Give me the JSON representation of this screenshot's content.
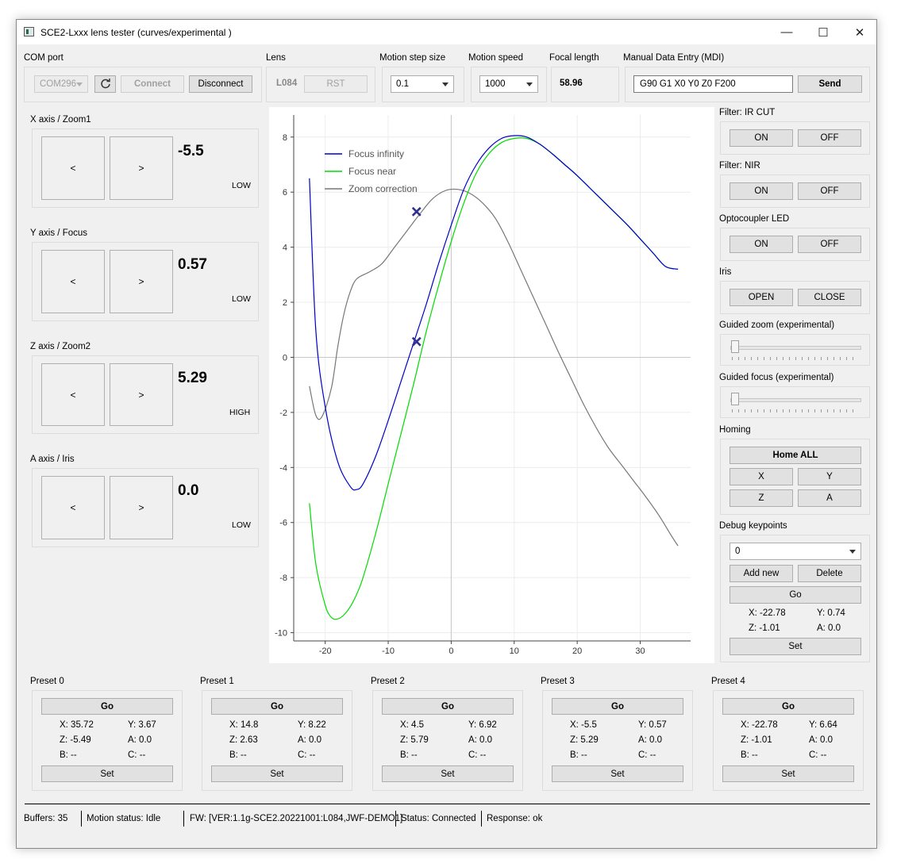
{
  "window": {
    "title": "SCE2-Lxxx lens tester (curves/experimental )",
    "min": "—",
    "max": "☐",
    "close": "✕"
  },
  "com": {
    "label": "COM port",
    "port": "COM296",
    "connect": "Connect",
    "disconnect": "Disconnect"
  },
  "lens": {
    "label": "Lens",
    "value": "L084",
    "rst": "RST"
  },
  "step": {
    "label": "Motion step size",
    "value": "0.1"
  },
  "speed": {
    "label": "Motion speed",
    "value": "1000"
  },
  "focal": {
    "label": "Focal length",
    "value": "58.96"
  },
  "mdi": {
    "label": "Manual Data Entry (MDI)",
    "value": "G90 G1 X0 Y0 Z0 F200",
    "send": "Send"
  },
  "axes": [
    {
      "label": "X axis / Zoom1",
      "value": "-5.5",
      "level": "LOW",
      "left": "<",
      "right": ">"
    },
    {
      "label": "Y axis / Focus",
      "value": "0.57",
      "level": "LOW",
      "left": "<",
      "right": ">"
    },
    {
      "label": "Z axis / Zoom2",
      "value": "5.29",
      "level": "HIGH",
      "left": "<",
      "right": ">"
    },
    {
      "label": "A axis / Iris",
      "value": "0.0",
      "level": "LOW",
      "left": "<",
      "right": ">"
    }
  ],
  "right": {
    "ircut": {
      "label": "Filter: IR CUT",
      "on": "ON",
      "off": "OFF"
    },
    "nir": {
      "label": "Filter: NIR",
      "on": "ON",
      "off": "OFF"
    },
    "opto": {
      "label": "Optocoupler LED",
      "on": "ON",
      "off": "OFF"
    },
    "iris": {
      "label": "Iris",
      "open": "OPEN",
      "close": "CLOSE"
    },
    "gzoom": {
      "label": "Guided zoom (experimental)",
      "value": 0
    },
    "gfocus": {
      "label": "Guided focus (experimental)",
      "value": 0
    },
    "homing": {
      "label": "Homing",
      "all": "Home ALL",
      "x": "X",
      "y": "Y",
      "z": "Z",
      "a": "A"
    },
    "debug": {
      "label": "Debug keypoints",
      "select": "0",
      "add": "Add new",
      "del": "Delete",
      "go": "Go",
      "x": "X:  -22.78",
      "y": "Y:  0.74",
      "z": "Z:  -1.01",
      "a": "A:  0.0",
      "set": "Set"
    }
  },
  "presets": [
    {
      "label": "Preset 0",
      "go": "Go",
      "x": "X:  35.72",
      "y": "Y:  3.67",
      "z": "Z:  -5.49",
      "a": "A:  0.0",
      "b": "B:  --",
      "c": "C:  --",
      "set": "Set"
    },
    {
      "label": "Preset 1",
      "go": "Go",
      "x": "X:  14.8",
      "y": "Y:  8.22",
      "z": "Z:  2.63",
      "a": "A:  0.0",
      "b": "B:  --",
      "c": "C:  --",
      "set": "Set"
    },
    {
      "label": "Preset 2",
      "go": "Go",
      "x": "X:  4.5",
      "y": "Y:  6.92",
      "z": "Z:  5.79",
      "a": "A:  0.0",
      "b": "B:  --",
      "c": "C:  --",
      "set": "Set"
    },
    {
      "label": "Preset 3",
      "go": "Go",
      "x": "X:  -5.5",
      "y": "Y:  0.57",
      "z": "Z:  5.29",
      "a": "A:  0.0",
      "b": "B:  --",
      "c": "C:  --",
      "set": "Set"
    },
    {
      "label": "Preset 4",
      "go": "Go",
      "x": "X:  -22.78",
      "y": "Y:  6.64",
      "z": "Z:  -1.01",
      "a": "A:  0.0",
      "b": "B:  --",
      "c": "C:  --",
      "set": "Set"
    }
  ],
  "status": {
    "buffers": "Buffers:  35",
    "motion": "Motion status:  Idle",
    "fw": "FW:  [VER:1.1g-SCE2.20221001:L084,JWF-DEMO1]",
    "conn": "Status:  Connected",
    "resp": "Response:  ok"
  },
  "chart_data": {
    "type": "line",
    "xlim": [
      -25,
      38
    ],
    "ylim": [
      -10.3,
      8.8
    ],
    "xticks": [
      -20,
      -10,
      0,
      10,
      20,
      30
    ],
    "yticks": [
      -10,
      -8,
      -6,
      -4,
      -2,
      0,
      2,
      4,
      6,
      8
    ],
    "grid": true,
    "legend_position": "top-left",
    "series": [
      {
        "name": "Focus infinity",
        "color": "#0000c8",
        "x": [
          -22.5,
          -21.5,
          -20,
          -18,
          -16,
          -15,
          -14,
          -12,
          -10,
          -8,
          -6,
          -4,
          -2,
          0,
          2,
          4,
          6,
          8,
          10,
          12,
          14,
          16,
          18,
          20,
          22,
          24,
          26,
          28,
          30,
          32,
          34,
          36
        ],
        "y": [
          6.5,
          1.0,
          -1.8,
          -3.8,
          -4.7,
          -4.8,
          -4.6,
          -3.6,
          -2.3,
          -0.9,
          0.5,
          1.9,
          3.4,
          4.8,
          6.1,
          7.0,
          7.6,
          7.95,
          8.05,
          8.0,
          7.75,
          7.4,
          7.0,
          6.6,
          6.15,
          5.7,
          5.25,
          4.8,
          4.3,
          3.8,
          3.3,
          3.2
        ]
      },
      {
        "name": "Focus near",
        "color": "#00dc00",
        "x": [
          -22.5,
          -21.5,
          -20,
          -19,
          -18,
          -17,
          -16,
          -15,
          -14,
          -12,
          -10,
          -8,
          -6,
          -4,
          -2,
          0,
          2,
          4,
          6,
          8,
          10,
          12,
          14,
          16,
          18,
          20,
          22,
          24,
          26,
          28,
          30,
          32,
          34,
          36
        ],
        "y": [
          -5.3,
          -7.5,
          -9.0,
          -9.45,
          -9.5,
          -9.35,
          -9.05,
          -8.6,
          -8.0,
          -6.4,
          -4.6,
          -2.8,
          -1.0,
          0.9,
          2.6,
          4.2,
          5.6,
          6.7,
          7.4,
          7.8,
          7.95,
          7.95,
          7.75,
          7.4,
          7.0,
          6.6,
          6.15,
          5.7,
          5.25,
          4.8,
          4.3,
          3.8,
          3.3,
          3.2
        ]
      },
      {
        "name": "Zoom correction",
        "color": "#777777",
        "x": [
          -22.5,
          -21.5,
          -20.5,
          -19,
          -18,
          -17,
          -16,
          -15,
          -13,
          -11,
          -9,
          -7,
          -5,
          -3,
          -1,
          1,
          3,
          5,
          7,
          9,
          11,
          13,
          15,
          17,
          19,
          21,
          23,
          25,
          27,
          29,
          31,
          33,
          35,
          36
        ],
        "y": [
          -1.05,
          -2.1,
          -2.15,
          -1.1,
          0.4,
          1.6,
          2.4,
          2.85,
          3.1,
          3.4,
          4.0,
          4.6,
          5.2,
          5.75,
          6.05,
          6.1,
          5.95,
          5.6,
          5.05,
          4.2,
          3.2,
          2.2,
          1.2,
          0.2,
          -0.75,
          -1.7,
          -2.55,
          -3.3,
          -3.9,
          -4.5,
          -5.1,
          -5.75,
          -6.5,
          -6.85
        ]
      }
    ],
    "markers": [
      {
        "x": -5.5,
        "y": 5.29,
        "symbol": "x",
        "color": "#303090"
      },
      {
        "x": -5.5,
        "y": 0.57,
        "symbol": "x",
        "color": "#303090"
      }
    ]
  }
}
